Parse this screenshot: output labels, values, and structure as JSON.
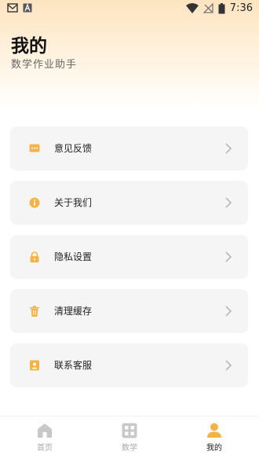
{
  "status_bar": {
    "time": "7:36",
    "left_icons": [
      "mail-icon",
      "a-app-icon"
    ],
    "right_icons": [
      "wifi-icon",
      "no-signal-icon",
      "battery-icon"
    ]
  },
  "header": {
    "title": "我的",
    "subtitle": "数学作业助手"
  },
  "menu": [
    {
      "label": "意见反馈",
      "icon": "feedback-icon"
    },
    {
      "label": "关于我们",
      "icon": "info-icon"
    },
    {
      "label": "隐私设置",
      "icon": "lock-icon"
    },
    {
      "label": "清理缓存",
      "icon": "trash-icon"
    },
    {
      "label": "联系客服",
      "icon": "contact-icon"
    }
  ],
  "tabs": [
    {
      "label": "首页",
      "icon": "home-icon",
      "active": false
    },
    {
      "label": "数学",
      "icon": "grid-icon",
      "active": false
    },
    {
      "label": "我的",
      "icon": "person-icon",
      "active": true
    }
  ],
  "colors": {
    "accent": "#f5b347",
    "inactive": "#c8c8c8",
    "card_bg": "#f5f5f5"
  }
}
